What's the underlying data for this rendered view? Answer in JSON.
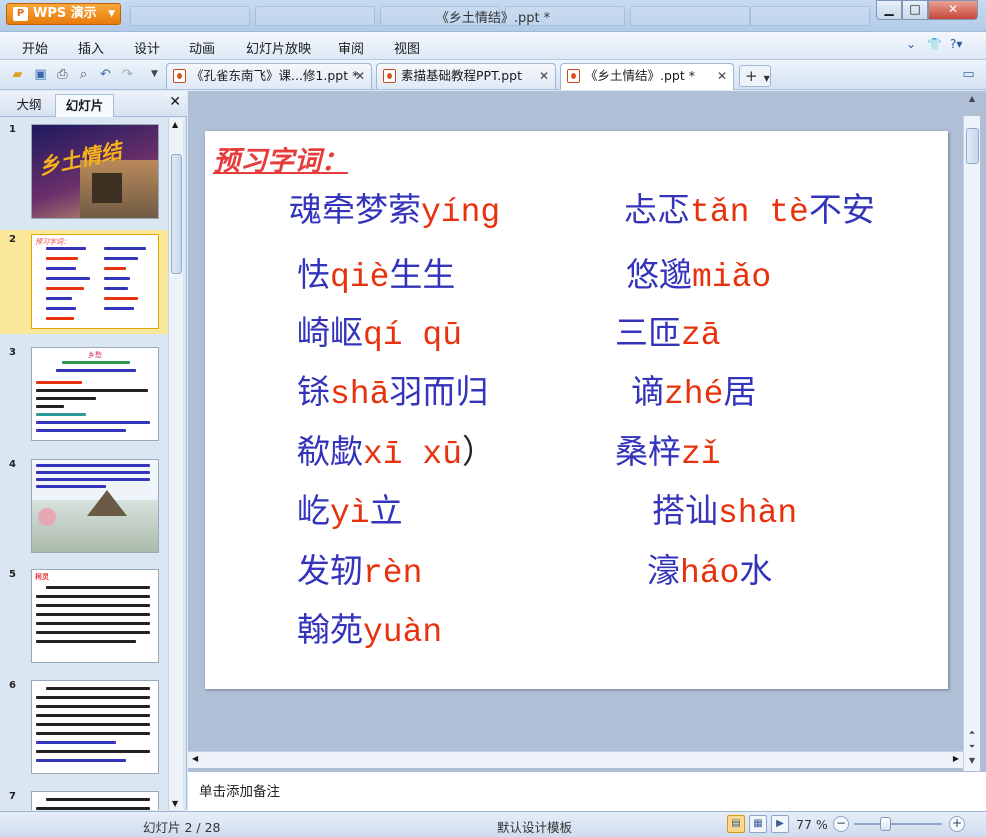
{
  "app": {
    "button_label": "WPS 演示",
    "window_title": "《乡土情结》.ppt *",
    "colors": {
      "accent_orange": "#e87a0c",
      "chrome_blue": "#c7daf0",
      "selected_slide": "#fbe79a"
    }
  },
  "menu": {
    "items": [
      "开始",
      "插入",
      "设计",
      "动画",
      "幻灯片放映",
      "审阅",
      "视图"
    ]
  },
  "toolbar": {
    "icons": [
      "open-folder-icon",
      "save-icon",
      "print-icon",
      "print-preview-icon",
      "undo-icon",
      "redo-icon",
      "customize-dropdown-icon"
    ]
  },
  "tabs": [
    {
      "label": "《孔雀东南飞》课...修1.ppt *",
      "active": false
    },
    {
      "label": "素描基础教程PPT.ppt",
      "active": false
    },
    {
      "label": "《乡土情结》.ppt *",
      "active": true
    }
  ],
  "left_panel": {
    "tab_outline": "大纲",
    "tab_slides": "幻灯片",
    "slides": [
      {
        "num": "1",
        "title": "乡土情结"
      },
      {
        "num": "2",
        "title": "预习字词："
      },
      {
        "num": "3",
        "title": "乡愁"
      },
      {
        "num": "4",
        "title": ""
      },
      {
        "num": "5",
        "title": "柯灵"
      },
      {
        "num": "6",
        "title": ""
      },
      {
        "num": "7",
        "title": ""
      }
    ]
  },
  "slide": {
    "heading": "预习字词：",
    "vocab": [
      {
        "hz": "魂牵梦萦",
        "py": "yíng"
      },
      {
        "hz": "忐忑",
        "py": "tǎn tè",
        "hz2": "不安"
      },
      {
        "hz": "怯",
        "py": "qiè",
        "hz2": "生生"
      },
      {
        "hz": "悠邈",
        "py": "miǎo"
      },
      {
        "hz": "崎岖",
        "py": "qí qū"
      },
      {
        "hz": "三匝",
        "py": "zā"
      },
      {
        "hz": "铩",
        "py": "shā",
        "hz2": "羽而归"
      },
      {
        "hz": "谪",
        "py": "zhé",
        "hz2": "居"
      },
      {
        "hz": "欷歔",
        "py": "xī xū",
        "tail": "）"
      },
      {
        "hz": "桑梓",
        "py": "zǐ"
      },
      {
        "hz": "屹",
        "py": "yì",
        "hz2": "立"
      },
      {
        "hz": "搭讪",
        "py": "shàn"
      },
      {
        "hz": "发轫",
        "py": "rèn"
      },
      {
        "hz": "濠",
        "py": "háo",
        "hz2": "水"
      },
      {
        "hz": "翰苑",
        "py": "yuàn"
      }
    ]
  },
  "notes": {
    "placeholder": "单击添加备注"
  },
  "status": {
    "slide_counter": "幻灯片 2 / 28",
    "template": "默认设计模板",
    "zoom": "77 %"
  }
}
